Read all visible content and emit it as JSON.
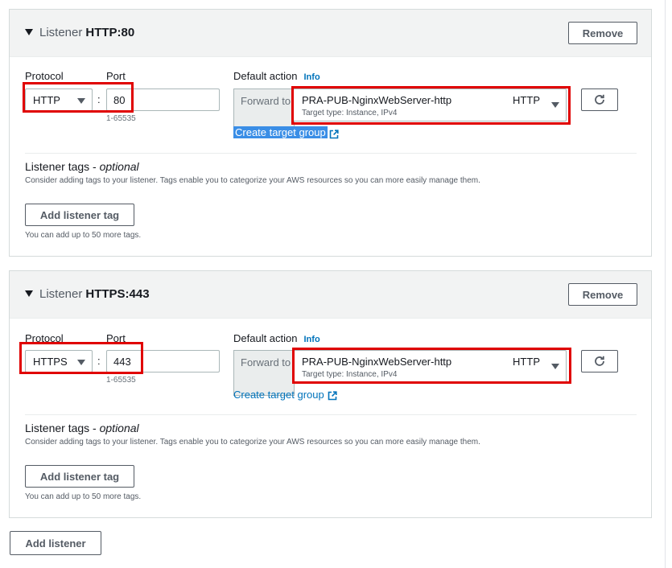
{
  "listeners": [
    {
      "header_label": "Listener",
      "header_value": "HTTP:80",
      "remove_label": "Remove",
      "protocol_label": "Protocol",
      "port_label": "Port",
      "protocol_value": "HTTP",
      "colon": ":",
      "port_value": "80",
      "port_hint": "1-65535",
      "default_action_label": "Default action",
      "info_label": "Info",
      "forward_to_label": "Forward to",
      "target_group_name": "PRA-PUB-NginxWebServer-http",
      "target_group_meta": "Target type: Instance, IPv4",
      "target_group_protocol": "HTTP",
      "create_target_group_label": "Create target group",
      "tags_title": "Listener tags -",
      "tags_optional": "optional",
      "tags_description": "Consider adding tags to your listener. Tags enable you to categorize your AWS resources so you can more easily manage them.",
      "add_tag_label": "Add listener tag",
      "tags_limit": "You can add up to 50 more tags."
    },
    {
      "header_label": "Listener",
      "header_value": "HTTPS:443",
      "remove_label": "Remove",
      "protocol_label": "Protocol",
      "port_label": "Port",
      "protocol_value": "HTTPS",
      "colon": ":",
      "port_value": "443",
      "port_hint": "1-65535",
      "default_action_label": "Default action",
      "info_label": "Info",
      "forward_to_label": "Forward to",
      "target_group_name": "PRA-PUB-NginxWebServer-http",
      "target_group_meta": "Target type: Instance, IPv4",
      "target_group_protocol": "HTTP",
      "create_target_group_label": "Create target group",
      "tags_title": "Listener tags -",
      "tags_optional": "optional",
      "tags_description": "Consider adding tags to your listener. Tags enable you to categorize your AWS resources so you can more easily manage them.",
      "add_tag_label": "Add listener tag",
      "tags_limit": "You can add up to 50 more tags."
    }
  ],
  "add_listener_label": "Add listener",
  "icons": {
    "collapse": "caret-down-icon",
    "dropdown": "triangle-down-icon",
    "refresh": "refresh-icon",
    "external_link": "external-link-icon"
  },
  "colors": {
    "highlight": "#e00000",
    "link": "#0073bb",
    "selection": "#3a8ee6"
  }
}
